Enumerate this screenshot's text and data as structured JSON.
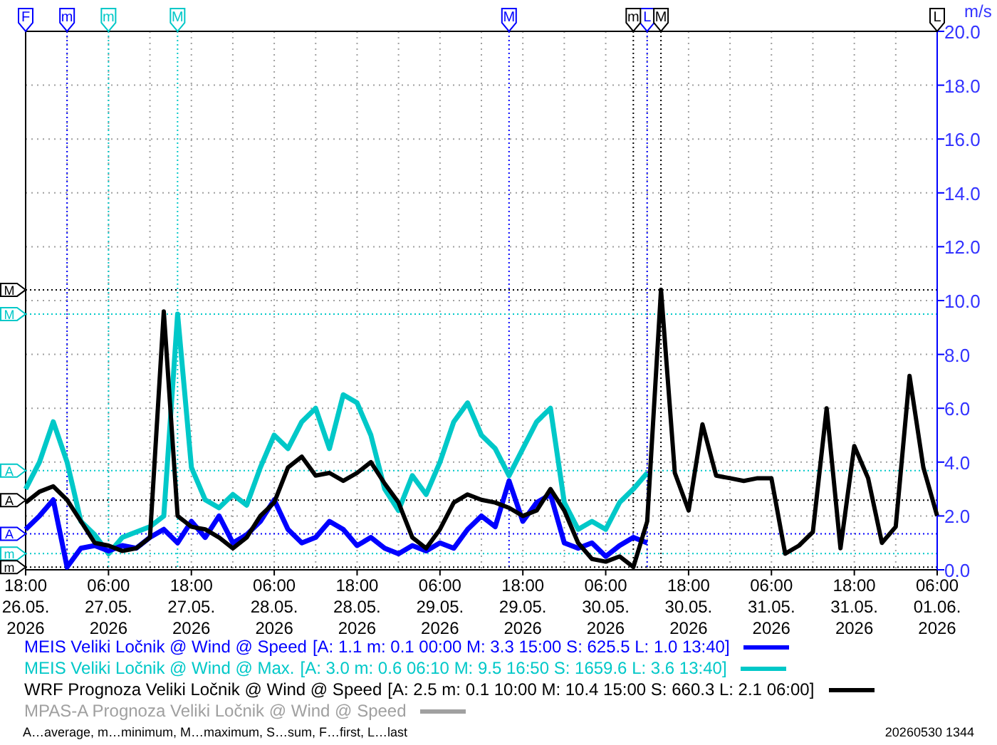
{
  "chart": {
    "chart_data": {
      "type": "line",
      "ylabel": "m/s",
      "ylim": [
        0,
        20
      ],
      "grid": true,
      "categories": [
        "18:00 26.05. 2026",
        null,
        null,
        null,
        null,
        null,
        "06:00 27.05. 2026",
        null,
        null,
        null,
        null,
        null,
        "18:00 27.05. 2026",
        null,
        null,
        null,
        null,
        null,
        "06:00 28.05. 2026",
        null,
        null,
        null,
        null,
        null,
        "18:00 28.05. 2026",
        null,
        null,
        null,
        null,
        null,
        "06:00 29.05. 2026",
        null,
        null,
        null,
        null,
        null,
        "18:00 29.05. 2026",
        null,
        null,
        null,
        null,
        null,
        "06:00 30.05. 2026",
        null,
        null,
        null,
        null,
        null,
        "18:00 30.05. 2026",
        null,
        null,
        null,
        null,
        null,
        "06:00 31.05. 2026",
        null,
        null,
        null,
        null,
        null,
        "18:00 31.05. 2026",
        null,
        null,
        null,
        null,
        null,
        "06:00 01.06. 2026"
      ],
      "yticks": [
        {
          "value": 0,
          "label": "0.0"
        },
        {
          "value": 2,
          "label": "2.0"
        },
        {
          "value": 4,
          "label": "4.0"
        },
        {
          "value": 6,
          "label": "6.0"
        },
        {
          "value": 8,
          "label": "8.0"
        },
        {
          "value": 10,
          "label": "10.0"
        },
        {
          "value": 12,
          "label": "12.0"
        },
        {
          "value": 14,
          "label": "14.0"
        },
        {
          "value": 16,
          "label": "16.0"
        },
        {
          "value": 18,
          "label": "18.0"
        },
        {
          "value": 20,
          "label": "20.0"
        }
      ],
      "series": [
        {
          "name": "MEIS Veliki Ločnik @ Wind @ Speed",
          "color": "#0000ff",
          "values": [
            1.5,
            2.0,
            2.6,
            0.1,
            0.8,
            0.9,
            0.7,
            0.9,
            0.8,
            1.2,
            1.5,
            1.0,
            1.8,
            1.2,
            2.0,
            1.0,
            1.3,
            1.8,
            2.6,
            1.5,
            1.0,
            1.2,
            1.8,
            1.5,
            0.9,
            1.2,
            0.8,
            0.6,
            0.9,
            0.7,
            1.0,
            0.8,
            1.5,
            2.0,
            1.6,
            3.3,
            1.8,
            2.5,
            2.8,
            1.0,
            0.8,
            1.0,
            0.5,
            0.9,
            1.2,
            1.0,
            null,
            null,
            null,
            null,
            null,
            null,
            null,
            null,
            null,
            null,
            null,
            null,
            null,
            null,
            null,
            null,
            null,
            null,
            null,
            null,
            null
          ]
        },
        {
          "name": "MEIS Veliki Ločnik @ Wind @ Max.",
          "color": "#00c8c8",
          "values": [
            3.0,
            4.0,
            5.5,
            4.0,
            1.8,
            1.3,
            0.6,
            1.2,
            1.4,
            1.6,
            2.0,
            9.5,
            3.8,
            2.6,
            2.3,
            2.8,
            2.4,
            3.8,
            5.0,
            4.5,
            5.5,
            6.0,
            4.5,
            6.5,
            6.2,
            5.0,
            3.0,
            2.2,
            3.5,
            2.8,
            4.0,
            5.5,
            6.2,
            5.0,
            4.5,
            3.5,
            4.5,
            5.5,
            6.0,
            2.5,
            1.5,
            1.8,
            1.5,
            2.5,
            3.0,
            3.6,
            null,
            null,
            null,
            null,
            null,
            null,
            null,
            null,
            null,
            null,
            null,
            null,
            null,
            null,
            null,
            null,
            null,
            null,
            null,
            null,
            null
          ]
        },
        {
          "name": "WRF Prognoza Veliki Ločnik @ Wind @ Speed",
          "color": "#000000",
          "values": [
            2.5,
            2.9,
            3.1,
            2.6,
            1.8,
            1.0,
            0.9,
            0.7,
            0.8,
            1.2,
            9.6,
            2.0,
            1.6,
            1.5,
            1.2,
            0.8,
            1.2,
            2.0,
            2.5,
            3.8,
            4.2,
            3.5,
            3.6,
            3.3,
            3.6,
            4.0,
            3.2,
            2.5,
            1.2,
            0.8,
            1.5,
            2.5,
            2.8,
            2.6,
            2.5,
            2.3,
            2.0,
            2.2,
            3.0,
            2.2,
            1.0,
            0.4,
            0.3,
            0.5,
            0.1,
            1.8,
            10.4,
            3.6,
            2.2,
            5.4,
            3.5,
            3.4,
            3.3,
            3.4,
            3.4,
            0.6,
            0.9,
            1.4,
            6.0,
            0.8,
            4.6,
            3.4,
            1.0,
            1.6,
            7.2,
            3.8,
            2.0
          ]
        },
        {
          "name": "MPAS-A Prognoza Veliki Ločnik @ Wind @ Speed",
          "color": "#a0a0a0",
          "values": [
            null,
            null,
            null,
            null,
            null,
            null,
            null,
            null,
            null,
            null,
            null,
            null,
            null,
            null,
            null,
            null,
            null,
            null,
            null,
            null,
            null,
            null,
            null,
            null,
            null,
            null,
            null,
            null,
            null,
            null,
            null,
            null,
            null,
            null,
            null,
            null,
            null,
            null,
            null,
            null,
            null,
            null,
            null,
            null,
            null,
            null,
            null,
            null,
            null,
            null,
            null,
            null,
            null,
            null,
            null,
            null,
            null,
            null,
            null,
            null,
            null,
            null,
            null,
            null,
            null,
            null,
            null
          ]
        }
      ]
    },
    "markers": [
      {
        "top": [
          {
            "kind": "first",
            "label": "F"
          },
          {
            "kind": "min",
            "label": "m"
          },
          {
            "kind": "max",
            "label": "M"
          },
          {
            "kind": "last",
            "label": "L"
          }
        ],
        "left": [
          {
            "kind": "average",
            "label": "A"
          }
        ]
      },
      {
        "top": [
          {
            "kind": "min",
            "label": "m"
          },
          {
            "kind": "max",
            "label": "M"
          }
        ],
        "left": [
          {
            "kind": "max",
            "label": "M"
          },
          {
            "kind": "average",
            "label": "A"
          },
          {
            "kind": "min",
            "label": "m"
          }
        ]
      },
      {
        "top": [
          {
            "kind": "min",
            "label": "m"
          },
          {
            "kind": "max",
            "label": "M"
          },
          {
            "kind": "last",
            "label": "L"
          }
        ],
        "left": [
          {
            "kind": "max",
            "label": "M"
          },
          {
            "kind": "average",
            "label": "A"
          },
          {
            "kind": "min",
            "label": "m"
          }
        ]
      }
    ],
    "legend": [
      {
        "stats": "[A: 1.1 m: 0.1 00:00 M: 3.3 15:00 S: 625.5 L: 1.0 13:40]"
      },
      {
        "stats": "[A: 3.0 m: 0.6 06:10 M: 9.5 16:50 S: 1659.6 L: 3.6 13:40]"
      },
      {
        "stats": "[A: 2.5 m: 0.1 10:00 M: 10.4 15:00 S: 660.3 L: 2.1 06:00]"
      }
    ]
  },
  "footer": {
    "key": "A…average, m…minimum, M…maximum, S…sum, F…first, L…last",
    "timestamp": "20260530 1344"
  }
}
